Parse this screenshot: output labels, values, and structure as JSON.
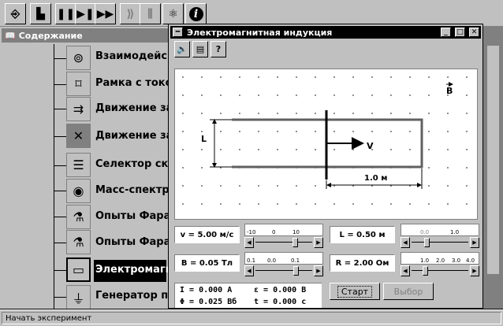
{
  "sidebar": {
    "title": "Содержание",
    "items": [
      {
        "label": "Взаимодейс",
        "icon": "rings-icon"
      },
      {
        "label": "Рамка с токо",
        "icon": "current-frame-icon"
      },
      {
        "label": "Движение за",
        "icon": "charge-motion-icon"
      },
      {
        "label": "Движение за",
        "icon": "magnetic-orbit-icon"
      },
      {
        "label": "Селектор ско",
        "icon": "velocity-selector-icon"
      },
      {
        "label": "Масс-спектр",
        "icon": "mass-spectrometer-icon"
      },
      {
        "label": "Опыты Фара",
        "icon": "faraday-experiment-icon"
      },
      {
        "label": "Опыты Фара",
        "icon": "faraday-experiment-icon"
      },
      {
        "label": "Электромагн",
        "icon": "electromagnetic-induction-icon",
        "selected": true
      },
      {
        "label": "Генератор п",
        "icon": "generator-icon"
      }
    ]
  },
  "window": {
    "title": "Электромагнитная индукция",
    "toolbar": [
      "sound-icon",
      "document-icon",
      "help-icon"
    ]
  },
  "canvas": {
    "b_label": "B",
    "l_label": "L",
    "v_label": "V",
    "distance_label": "1.0 м"
  },
  "fields": {
    "v": "v = 5.00 м/с",
    "L": "L = 0.50 м",
    "B": "B = 0.05 Тл",
    "R": "R = 2.00 Ом"
  },
  "sliders": {
    "v_scale": [
      "-10",
      "0",
      "10"
    ],
    "L_scale": [
      "0.0",
      "1.0"
    ],
    "B_scale": [
      "0.1",
      "0.0",
      "0.1"
    ],
    "R_scale": [
      "1.0",
      "2.0",
      "3.0",
      "4.0"
    ]
  },
  "readouts": {
    "I": "I  = 0.000 A",
    "emf": "ε  = 0.000 В",
    "phi": "Φ = 0.025 Вб",
    "t": "t  = 0.000 с"
  },
  "buttons": {
    "start": "Старт",
    "choose": "Выбор"
  },
  "status": "Начать эксперимент"
}
